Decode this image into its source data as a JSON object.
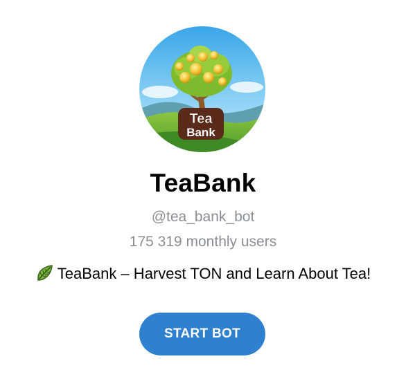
{
  "bot": {
    "name": "TeaBank",
    "username": "@tea_bank_bot",
    "monthly_users": "175 319 monthly users",
    "description": "TeaBank – Harvest TON and Learn About Tea!",
    "description_icon": "leaf-icon",
    "avatar_logo_line1": "Tea",
    "avatar_logo_line2": "Bank"
  },
  "actions": {
    "start_label": "START BOT"
  },
  "colors": {
    "button": "#2f80cf",
    "secondary_text": "#8a8f94"
  }
}
